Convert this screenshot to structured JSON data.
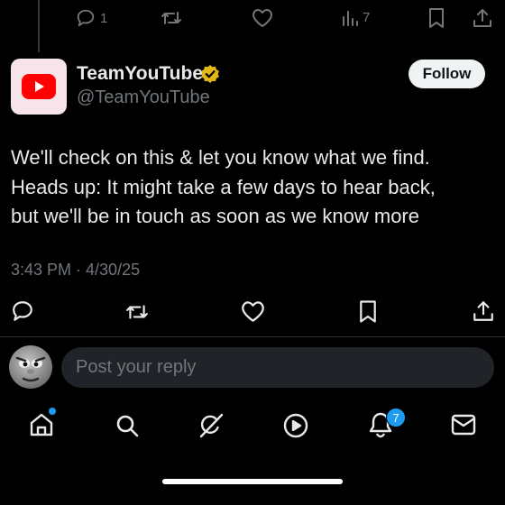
{
  "top_actions": {
    "reply_count": "1",
    "views_count": "7"
  },
  "author": {
    "display_name": "TeamYouTube",
    "handle": "@TeamYouTube",
    "follow_label": "Follow"
  },
  "tweet": {
    "lines": [
      "We'll check on this & let you know what we find.",
      "Heads up: It might take a few days to hear back,",
      "but we'll be in touch as soon as we know more"
    ],
    "timestamp": "3:43 PM · 4/30/25"
  },
  "reply": {
    "placeholder": "Post your reply"
  },
  "nav": {
    "notifications_badge": "7"
  },
  "colors": {
    "background": "#000000",
    "text": "#e7e9ea",
    "muted": "#71767b",
    "accent": "#1d9bf0",
    "youtube_red": "#ff0000",
    "verified_gold": "#e2b719"
  },
  "icons": [
    "reply-icon",
    "retweet-icon",
    "like-icon",
    "views-icon",
    "bookmark-icon",
    "share-icon",
    "youtube-logo",
    "verified-badge-icon",
    "home-icon",
    "search-icon",
    "grok-icon",
    "video-icon",
    "notifications-icon",
    "messages-icon"
  ]
}
